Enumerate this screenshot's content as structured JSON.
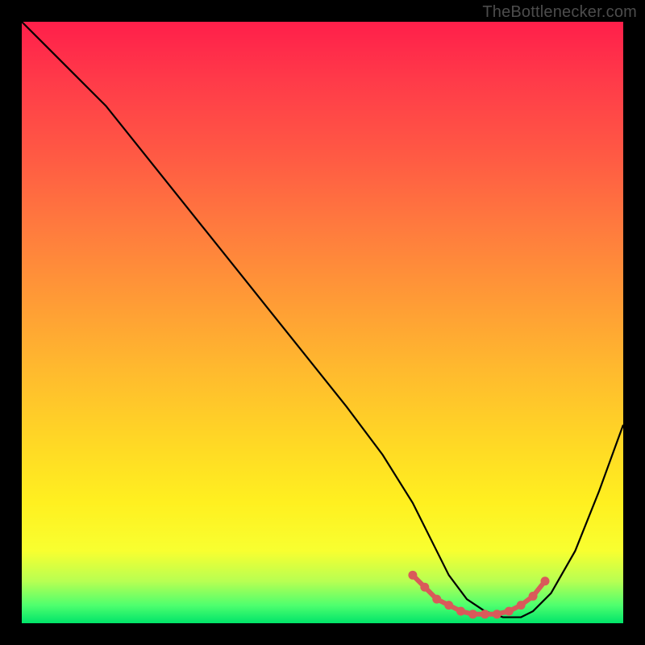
{
  "watermark": "TheBottlenecker.com",
  "colors": {
    "page_bg": "#000000",
    "curve": "#000000",
    "marker": "#d95a5a",
    "gradient_top": "#ff1f4a",
    "gradient_bottom": "#00e46a"
  },
  "chart_data": {
    "type": "line",
    "title": "",
    "xlabel": "",
    "ylabel": "",
    "xlim": [
      0,
      100
    ],
    "ylim": [
      0,
      100
    ],
    "grid": false,
    "legend": false,
    "annotations": [
      "TheBottlenecker.com"
    ],
    "series": [
      {
        "name": "bottleneck-curve",
        "x": [
          0,
          4,
          8,
          14,
          22,
          30,
          38,
          46,
          54,
          60,
          65,
          68,
          71,
          74,
          77,
          80,
          83,
          85,
          88,
          92,
          96,
          100
        ],
        "values": [
          100,
          96,
          92,
          86,
          76,
          66,
          56,
          46,
          36,
          28,
          20,
          14,
          8,
          4,
          2,
          1,
          1,
          2,
          5,
          12,
          22,
          33
        ]
      }
    ],
    "markers": {
      "name": "optimal-range",
      "x": [
        65,
        67,
        69,
        71,
        73,
        75,
        77,
        79,
        81,
        83,
        85,
        87
      ],
      "values": [
        8,
        6,
        4,
        3,
        2,
        1.5,
        1.5,
        1.5,
        2,
        3,
        4.5,
        7
      ]
    }
  }
}
